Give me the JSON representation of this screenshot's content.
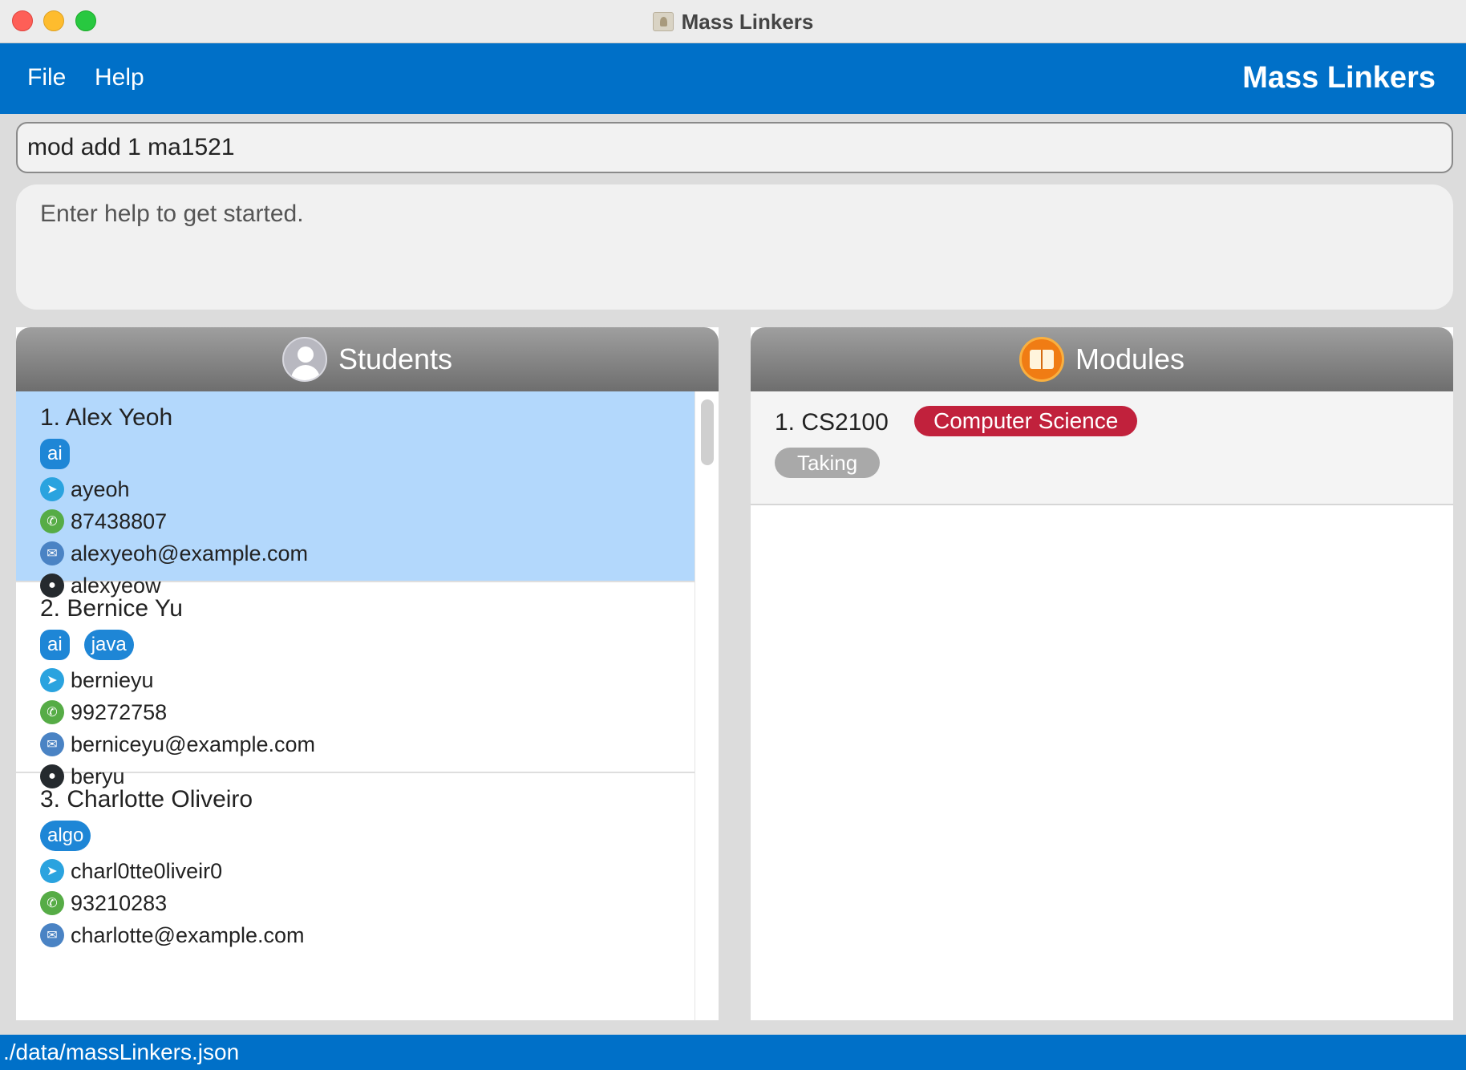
{
  "window": {
    "title": "Mass Linkers"
  },
  "menu": {
    "items": [
      "File",
      "Help"
    ],
    "brand": "Mass Linkers"
  },
  "command": {
    "value": "mod add 1 ma1521"
  },
  "result": {
    "text": "Enter help to get started."
  },
  "students": {
    "title": "Students",
    "items": [
      {
        "name": "1. Alex Yeoh",
        "tags": [
          "ai"
        ],
        "telegram": "ayeoh",
        "phone": "87438807",
        "email": "alexyeoh@example.com",
        "github": "alexyeow"
      },
      {
        "name": "2. Bernice Yu",
        "tags": [
          "ai",
          "java"
        ],
        "telegram": "bernieyu",
        "phone": "99272758",
        "email": "berniceyu@example.com",
        "github": "beryu"
      },
      {
        "name": "3. Charlotte Oliveiro",
        "tags": [
          "algo"
        ],
        "telegram": "charl0tte0liveir0",
        "phone": "93210283",
        "email": "charlotte@example.com"
      }
    ]
  },
  "modules": {
    "title": "Modules",
    "items": [
      {
        "code": "1. CS2100",
        "department": "Computer Science",
        "status": "Taking"
      }
    ]
  },
  "statusbar": {
    "path": "./data/massLinkers.json"
  },
  "colors": {
    "brand_blue": "#0070c8",
    "selected_row": "#b3d8fc",
    "tag_blue": "#1e86d6",
    "department_red": "#c1213c",
    "status_gray": "#a9a9a9"
  },
  "icons": {
    "telegram": "telegram-icon",
    "phone": "phone-icon",
    "email": "email-icon",
    "github": "github-icon",
    "students": "person-icon",
    "modules": "book-icon"
  }
}
